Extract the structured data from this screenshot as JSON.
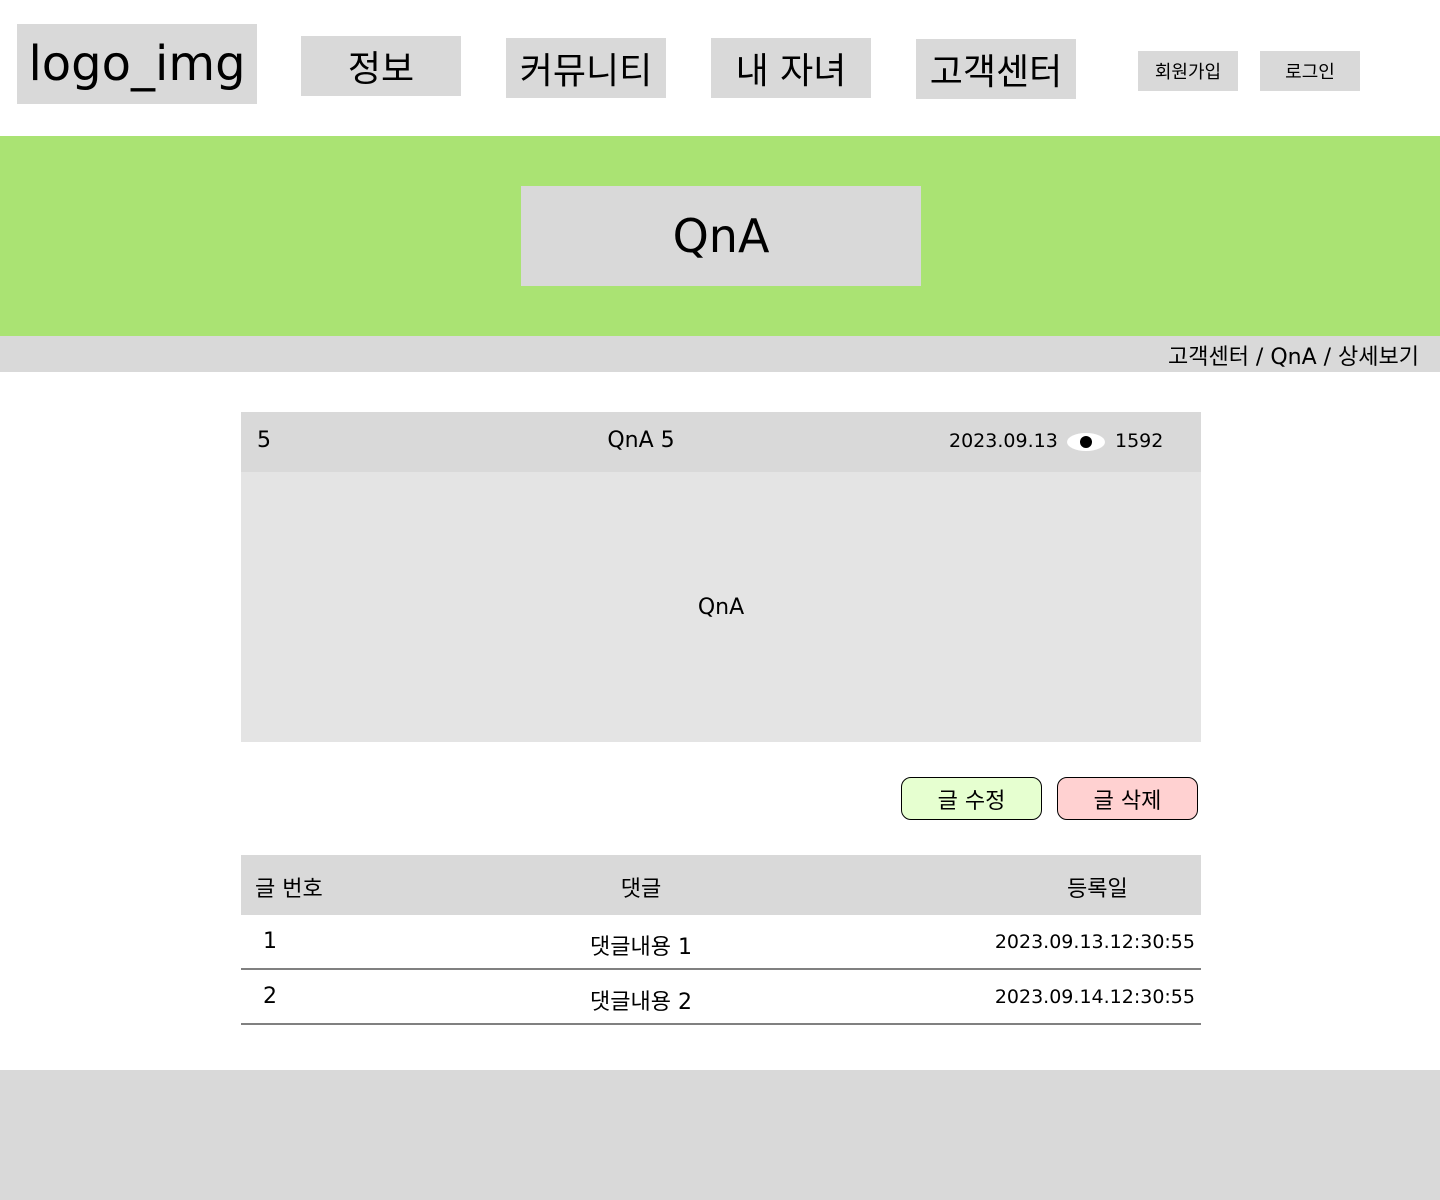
{
  "header": {
    "logo": "logo_img",
    "nav": [
      "정보",
      "커뮤니티",
      "내 자녀",
      "고객센터"
    ],
    "signup": "회원가입",
    "login": "로그인"
  },
  "hero": {
    "title": "QnA",
    "bg_color": "#aae373"
  },
  "breadcrumb": "고객센터 / QnA / 상세보기",
  "post": {
    "number": "5",
    "title": "QnA 5",
    "date": "2023.09.13",
    "views": "1592",
    "views_icon": "eye-icon",
    "body": "QnA"
  },
  "actions": {
    "edit": "글 수정",
    "delete": "글 삭제",
    "edit_color": "#e6ffd0",
    "delete_color": "#ffd1d1"
  },
  "comments": {
    "headers": [
      "글 번호",
      "댓글",
      "등록일"
    ],
    "rows": [
      {
        "no": "1",
        "text": "댓글내용 1",
        "date": "2023.09.13.12:30:55"
      },
      {
        "no": "2",
        "text": "댓글내용 2",
        "date": "2023.09.14.12:30:55"
      }
    ]
  }
}
